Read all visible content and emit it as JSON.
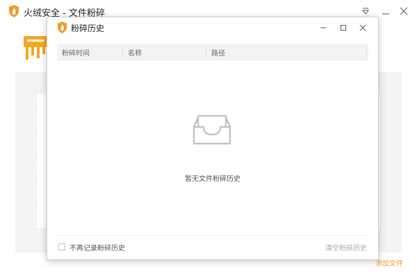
{
  "main_window": {
    "title": "火绒安全 - 文件粉碎",
    "add_file_link": "添加文件"
  },
  "dialog": {
    "title": "粉碎历史",
    "columns": [
      "粉碎时间",
      "名称",
      "路径"
    ],
    "rows": [],
    "empty_message": "暂无文件粉碎历史",
    "checkbox_label": "不再记录粉碎历史",
    "checkbox_checked": false,
    "clear_button": "清空粉碎历史"
  },
  "icons": {
    "app_logo": "huorong-flame-shield-icon",
    "main_menu": "dropdown-menu-icon",
    "main_minimize": "minimize-icon",
    "main_close": "close-icon",
    "dialog_minimize": "minimize-icon",
    "dialog_maximize": "maximize-icon",
    "dialog_close": "close-icon",
    "empty_state": "empty-tray-icon",
    "shredder": "shredder-illustration"
  },
  "colors": {
    "brand_orange": "#f29a2e",
    "header_bg": "#f3f3f3",
    "muted_text": "#aaaaaa"
  }
}
